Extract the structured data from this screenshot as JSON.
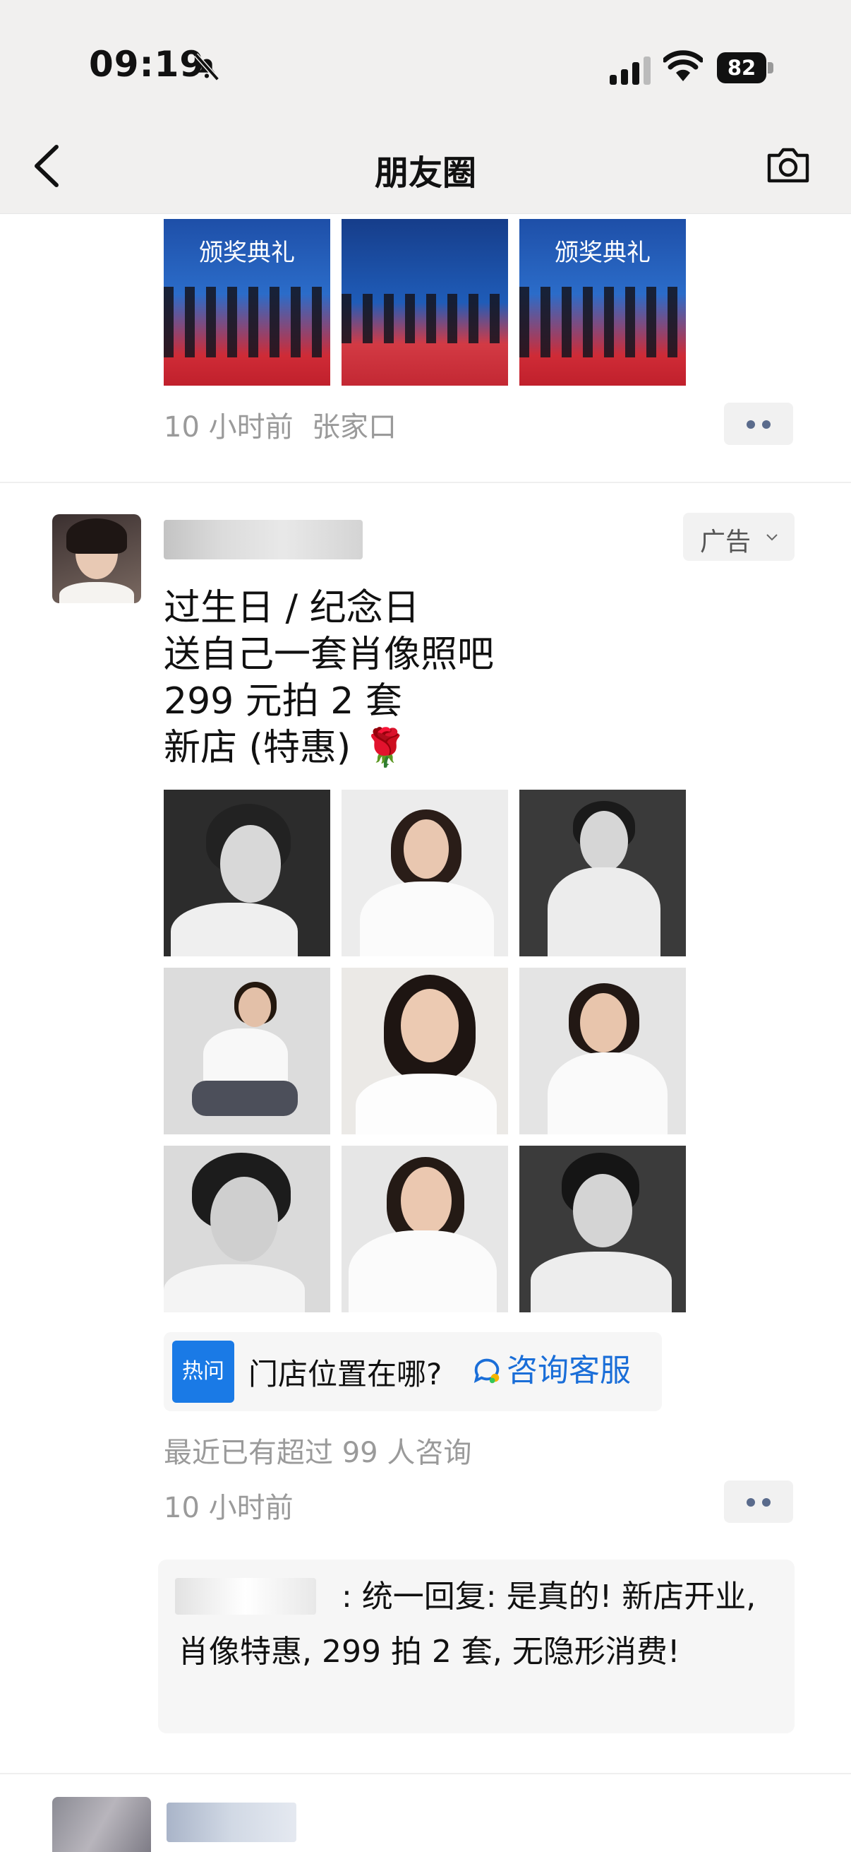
{
  "status_bar": {
    "time": "09:19",
    "battery": "82",
    "icons": [
      "bell-slash-icon",
      "cellular-signal-icon",
      "wifi-icon",
      "battery-icon"
    ]
  },
  "nav": {
    "title": "朋友圈",
    "back_icon": "chevron-left-icon",
    "camera_icon": "camera-icon"
  },
  "post1": {
    "banner_text_1": "颁奖典礼",
    "banner_text_3": "颁奖典礼",
    "time": "10 小时前",
    "location": "张家口"
  },
  "post2": {
    "ad_label": "广告",
    "lines": [
      "过生日 / 纪念日",
      "送自己一套肖像照吧",
      "299 元拍 2 套",
      "新店 (特惠) 🌹"
    ],
    "hot": {
      "badge": "热问",
      "question": "门店位置在哪?",
      "consult_label": "咨询客服"
    },
    "consult_count": "最近已有超过 99 人咨询",
    "time": "10 小时前",
    "reply": ": 统一回复: 是真的! 新店开业, 肖像特惠, 299 拍 2 套, 无隐形消费!"
  },
  "colors": {
    "link_blue": "#1a6ed8",
    "badge_blue": "#1a7ae6",
    "meta_gray": "#9a9a9a",
    "dots_blue": "#5a6b8c"
  }
}
